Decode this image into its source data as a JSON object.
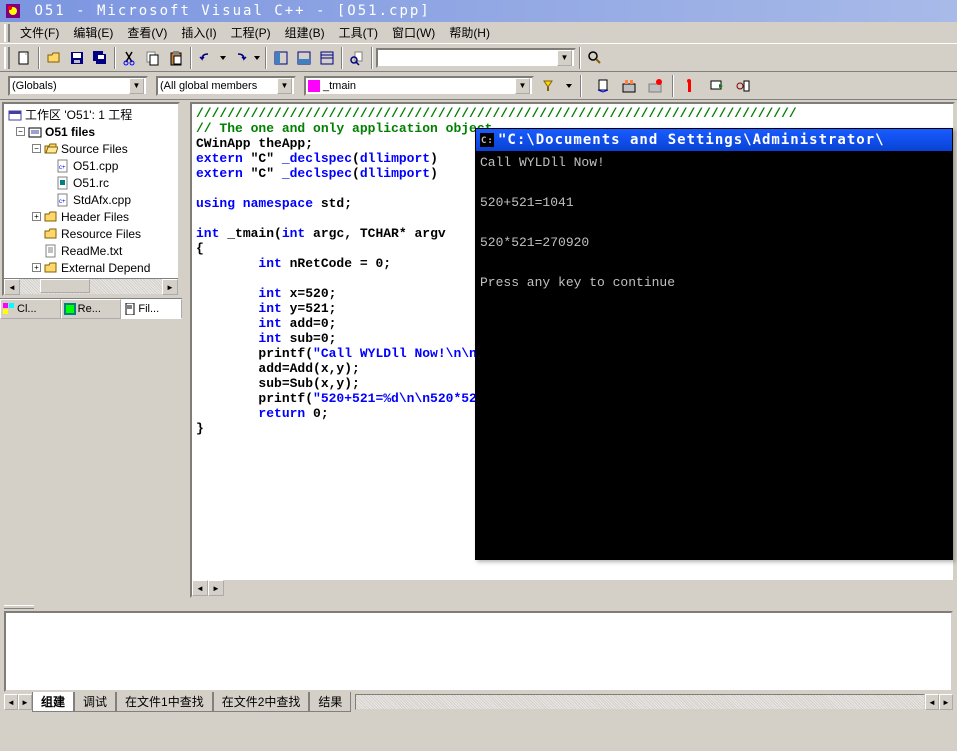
{
  "titlebar": "O51 - Microsoft Visual C++ - [O51.cpp]",
  "menu": {
    "file": "文件(F)",
    "edit": "编辑(E)",
    "view": "查看(V)",
    "insert": "插入(I)",
    "project": "工程(P)",
    "build": "组建(B)",
    "tools": "工具(T)",
    "window": "窗口(W)",
    "help": "帮助(H)"
  },
  "combos": {
    "scope": "(Globals)",
    "members": "(All global members",
    "func": "_tmain",
    "search": ""
  },
  "tree": {
    "workspace": "工作区 'O51': 1 工程",
    "project": "O51 files",
    "source_folder": "Source Files",
    "files": [
      "O51.cpp",
      "O51.rc",
      "StdAfx.cpp"
    ],
    "header_folder": "Header Files",
    "resource_folder": "Resource Files",
    "readme": "ReadMe.txt",
    "external": "External Depend"
  },
  "sidetabs": {
    "class": "Cl...",
    "resource": "Re...",
    "file": "Fil..."
  },
  "code": {
    "l1": "/////////////////////////////////////////////////////////////////////////////",
    "l2": "// The one and only application object",
    "l3a": "CWinApp theApp;",
    "l4a": "extern ",
    "l4b": "\"C\" ",
    "l4c": "_declspec",
    "l4d": "(",
    "l4e": "dllimport",
    "l4f": ")",
    "l5a": "extern ",
    "l5b": "\"C\" ",
    "l5c": "_declspec",
    "l5d": "(",
    "l5e": "dllimport",
    "l5f": ")",
    "l7a": "using namespace ",
    "l7b": "std;",
    "l9a": "int ",
    "l9b": "_tmain(",
    "l9c": "int ",
    "l9d": "argc, TCHAR* argv",
    "l10": "{",
    "l11a": "        int ",
    "l11b": "nRetCode = 0;",
    "l13a": "        int ",
    "l13b": "x=520;",
    "l14a": "        int ",
    "l14b": "y=521;",
    "l15a": "        int ",
    "l15b": "add=0;",
    "l16a": "        int ",
    "l16b": "sub=0;",
    "l17a": "        printf(",
    "l17b": "\"Call WYLDll Now!\\n\\n",
    "l18": "        add=Add(x,y);",
    "l19": "        sub=Sub(x,y);",
    "l20a": "        printf(",
    "l20b": "\"520+521=%d\\n\\n520*52",
    "l21a": "        return ",
    "l21b": "0;",
    "l22": "}"
  },
  "console": {
    "title": "\"C:\\Documents and Settings\\Administrator\\",
    "l1": "Call WYLDll Now!",
    "l2": "520+521=1041",
    "l3": "520*521=270920",
    "l4": "Press any key to continue"
  },
  "bottom_tabs": {
    "build": "组建",
    "debug": "调试",
    "find1": "在文件1中查找",
    "find2": "在文件2中查找",
    "results": "结果"
  }
}
